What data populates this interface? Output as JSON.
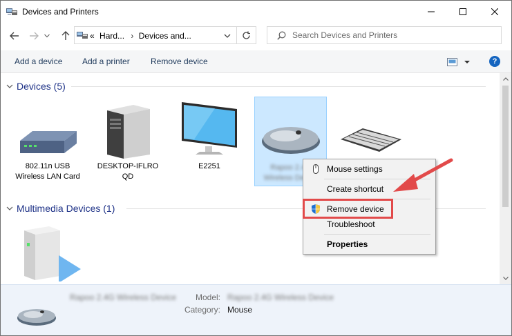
{
  "window": {
    "title": "Devices and Printers"
  },
  "address": {
    "crumbs": [
      "«",
      "Hard...",
      "›",
      "Devices and..."
    ]
  },
  "search": {
    "placeholder": "Search Devices and Printers"
  },
  "commands": {
    "add_device": "Add a device",
    "add_printer": "Add a printer",
    "remove_device": "Remove device",
    "help": "?"
  },
  "groups": {
    "devices": {
      "title": "Devices (5)"
    },
    "multimedia": {
      "title": "Multimedia Devices (1)"
    }
  },
  "devices": [
    {
      "label": "802.11n USB Wireless LAN Card",
      "icon": "wireless-router-icon"
    },
    {
      "label": "DESKTOP-IFLRO QD",
      "icon": "desktop-tower-icon"
    },
    {
      "label": "E2251",
      "icon": "monitor-icon"
    },
    {
      "label": "Rapoo 2.4G Wireless Device",
      "icon": "mouse-icon",
      "selected": true
    },
    {
      "label": "",
      "icon": "keyboard-icon"
    }
  ],
  "multimedia_devices": [
    {
      "label": "",
      "icon": "media-device-icon"
    }
  ],
  "context_menu": {
    "items": [
      {
        "label": "Mouse settings",
        "icon": "mouse-small-icon"
      },
      {
        "label": "Create shortcut"
      },
      {
        "label": "Remove device",
        "icon": "shield-icon"
      },
      {
        "label": "Troubleshoot"
      },
      {
        "label": "Properties",
        "bold": true
      }
    ]
  },
  "details": {
    "name": "Rapoo 2.4G Wireless Device",
    "model_key": "Model:",
    "model_val": "Rapoo 2.4G Wireless Device",
    "category_key": "Category:",
    "category_val": "Mouse"
  },
  "colors": {
    "accent": "#1e3287",
    "selection": "#cce8ff",
    "highlight": "#e24a4a",
    "details_bg": "#eef3fa"
  }
}
